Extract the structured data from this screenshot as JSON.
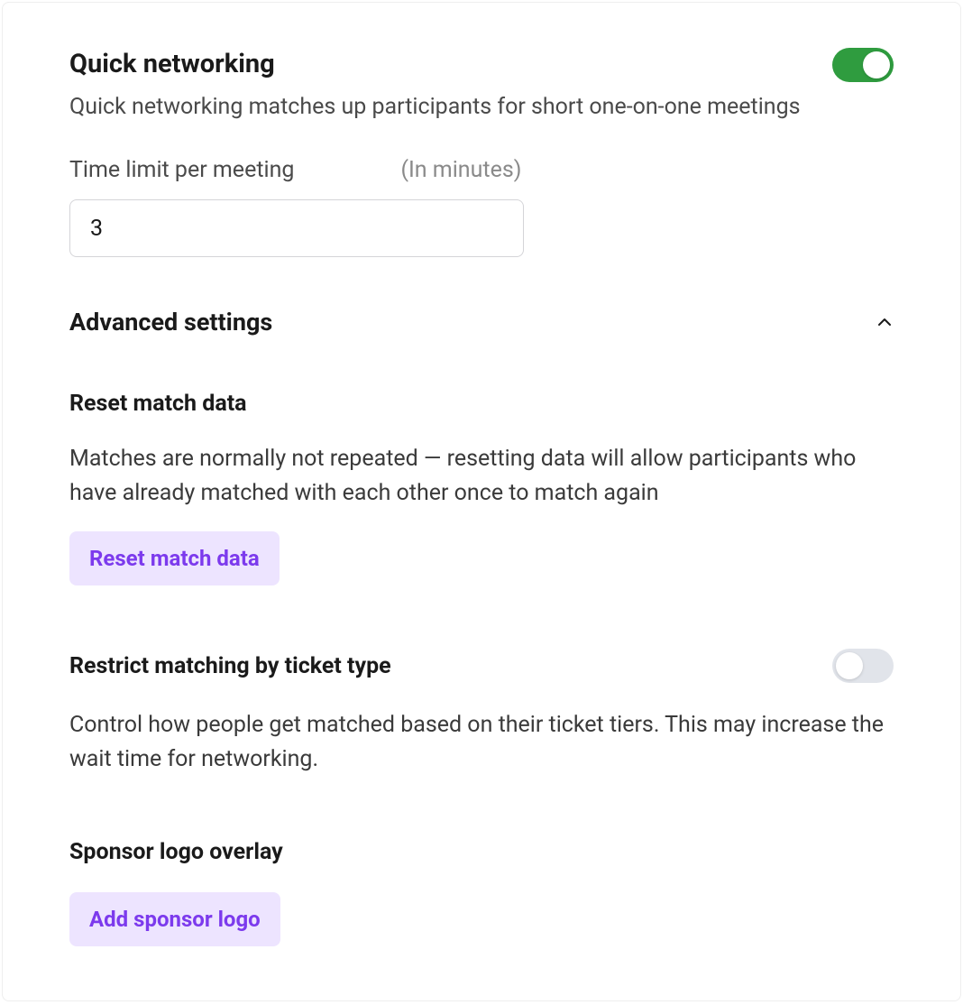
{
  "quickNetworking": {
    "title": "Quick networking",
    "description": "Quick networking matches up participants for short one-on-one meetings",
    "enabled": true,
    "timeLimit": {
      "label": "Time limit per meeting",
      "hint": "(In minutes)",
      "value": "3"
    }
  },
  "advanced": {
    "title": "Advanced settings",
    "expanded": true,
    "resetMatch": {
      "title": "Reset match data",
      "description": "Matches are normally not repeated — resetting data will allow participants who have already matched with each other once to match again",
      "buttonLabel": "Reset match data"
    },
    "restrictMatching": {
      "title": "Restrict matching by ticket type",
      "description": "Control how people get matched based on their ticket tiers. This may increase the wait time for networking.",
      "enabled": false
    },
    "sponsorLogo": {
      "title": "Sponsor logo overlay",
      "buttonLabel": "Add sponsor logo"
    }
  }
}
